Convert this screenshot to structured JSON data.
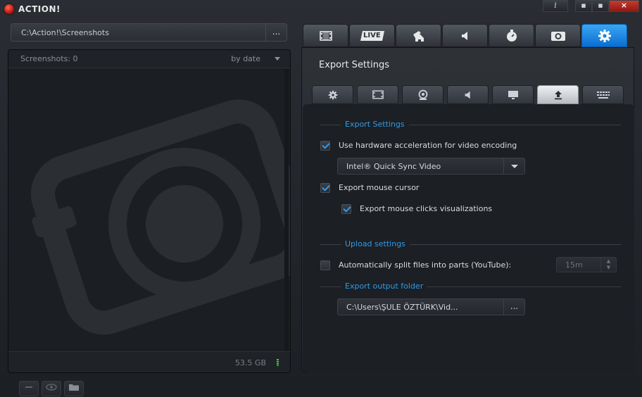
{
  "app": {
    "title": "ACTION!"
  },
  "window_buttons": {
    "info": "i",
    "minimize": "▪",
    "maximize": "▪",
    "close": "×"
  },
  "left": {
    "path": "C:\\Action!\\Screenshots",
    "path_more": "...",
    "count_label": "Screenshots: 0",
    "sort_label": "by date",
    "disk_free": "53.5 GB"
  },
  "top_tabs": [
    {
      "icon": "film-icon"
    },
    {
      "label": "LIVE",
      "icon": "live-icon"
    },
    {
      "icon": "gamepad-icon"
    },
    {
      "icon": "speaker-icon"
    },
    {
      "icon": "stopwatch-icon"
    },
    {
      "icon": "camera-icon"
    },
    {
      "icon": "gear-icon",
      "active": true
    }
  ],
  "panel": {
    "title": "Export Settings"
  },
  "sub_tabs": [
    {
      "icon": "gear-icon"
    },
    {
      "icon": "film-icon"
    },
    {
      "icon": "webcam-icon"
    },
    {
      "icon": "speaker-icon"
    },
    {
      "icon": "monitor-icon"
    },
    {
      "icon": "upload-icon",
      "active": true
    },
    {
      "icon": "keyboard-icon"
    }
  ],
  "export": {
    "section_label": "Export Settings",
    "hw_accel_label": "Use hardware acceleration for video encoding",
    "hw_accel_checked": true,
    "encoder_value": "Intel® Quick Sync Video",
    "mouse_cursor_label": "Export mouse cursor",
    "mouse_cursor_checked": true,
    "mouse_clicks_label": "Export mouse clicks visualizations",
    "mouse_clicks_checked": true
  },
  "upload": {
    "section_label": "Upload settings",
    "split_label": "Automatically split files into parts (YouTube):",
    "split_checked": false,
    "split_value": "15m"
  },
  "output": {
    "section_label": "Export output folder",
    "path": "C:\\Users\\ŞULE ÖZTÜRK\\Vid...",
    "more": "..."
  },
  "colors": {
    "accent": "#2f9be8",
    "active_tab": "#1a84e0"
  }
}
